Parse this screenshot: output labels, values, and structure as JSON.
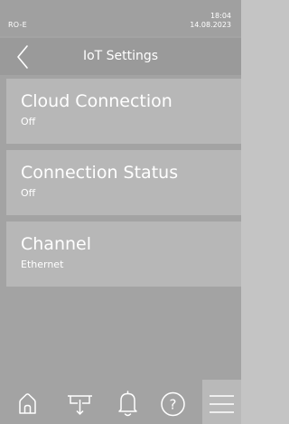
{
  "status_bar": {
    "device": "RO-E",
    "time": "18:04",
    "date": "14.08.2023"
  },
  "header": {
    "title": "IoT Settings",
    "back_icon": "chevron-left-icon"
  },
  "items": [
    {
      "title": "Cloud Connection",
      "value": "Off"
    },
    {
      "title": "Connection Status",
      "value": "Off"
    },
    {
      "title": "Channel",
      "value": "Ethernet"
    }
  ],
  "bottom_nav": {
    "icons": [
      "home-icon",
      "service-icon",
      "bell-icon",
      "help-icon",
      "menu-icon"
    ],
    "help_glyph": "?"
  },
  "colors": {
    "background": "#a3a3a3",
    "item_background": "#b7b7b7",
    "header_background": "#9a9a9a",
    "menu_active_background": "#b9b9b9",
    "text": "#ffffff"
  }
}
